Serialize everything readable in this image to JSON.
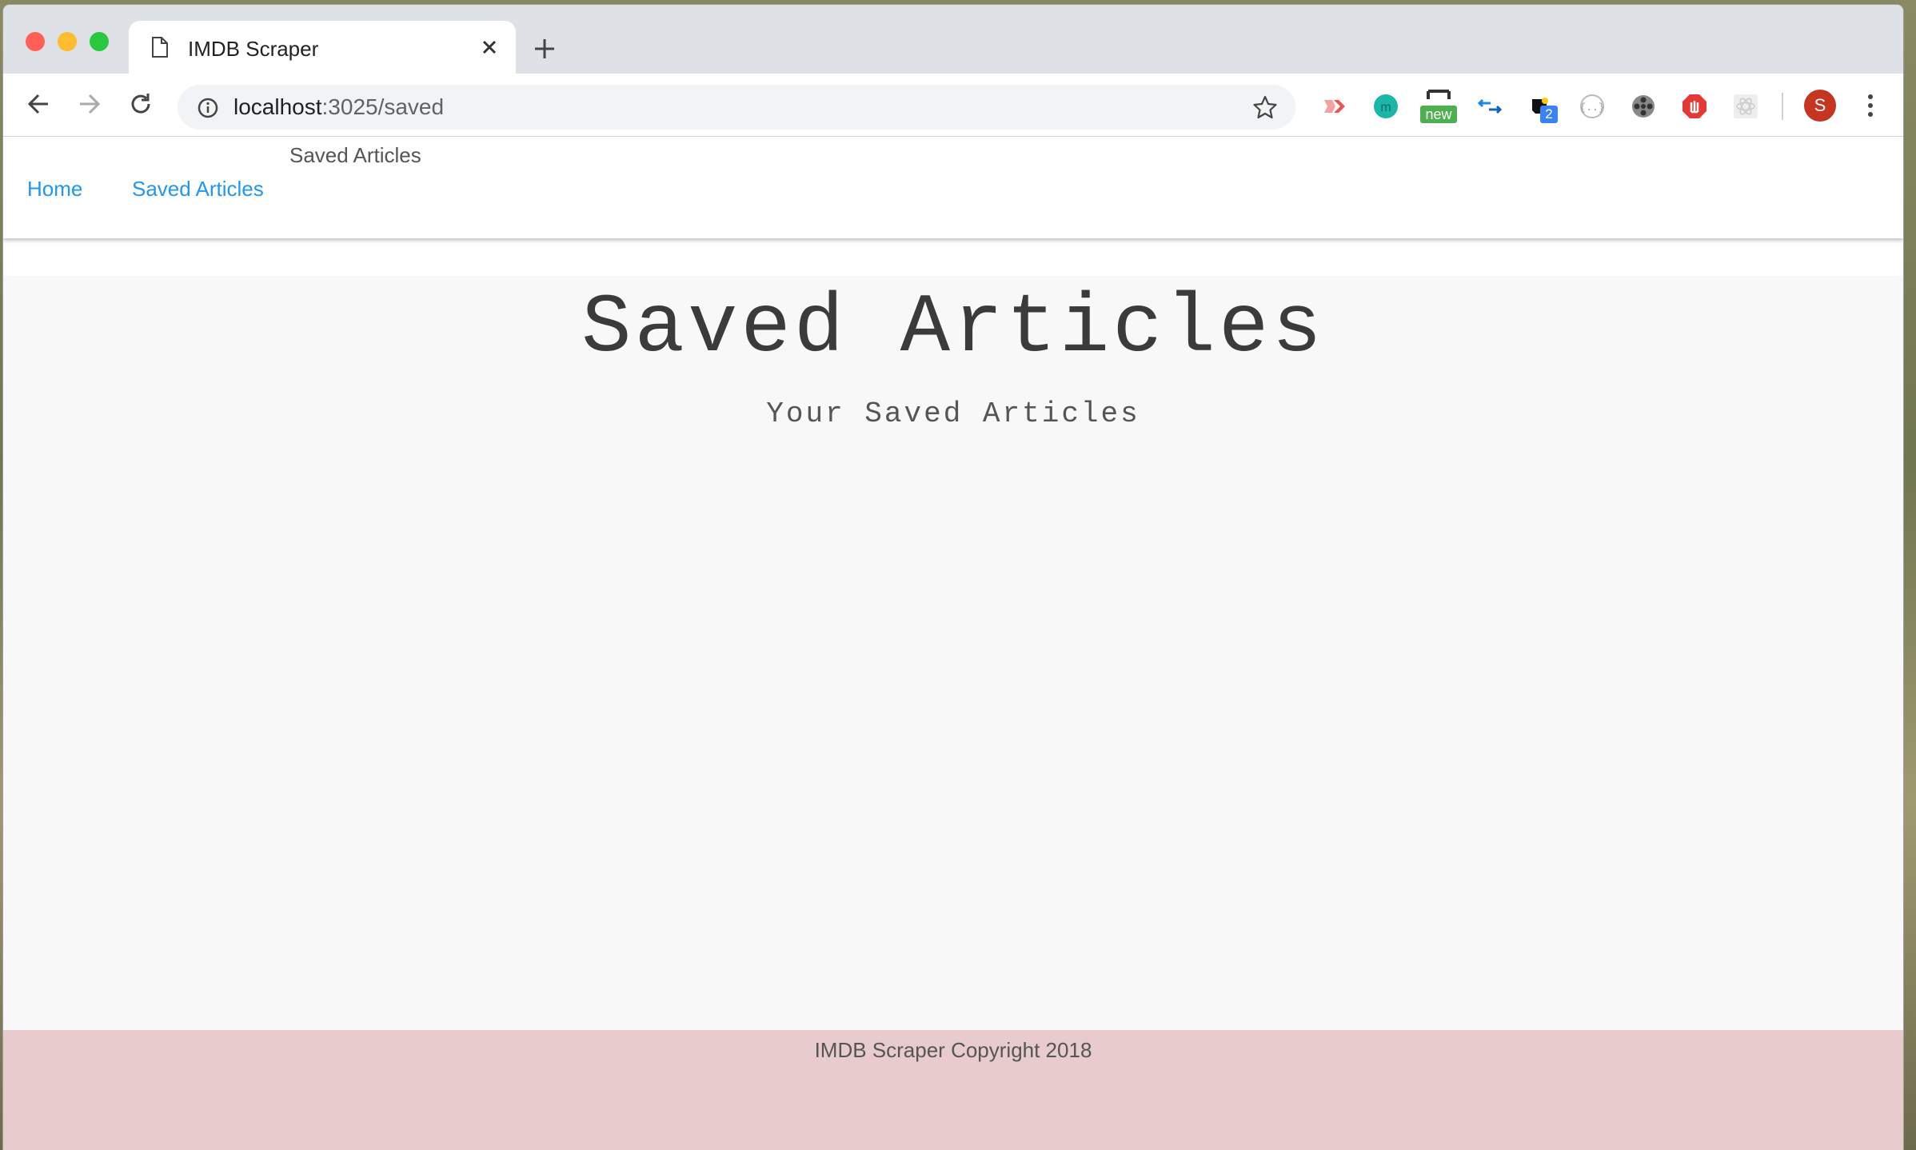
{
  "browser": {
    "tab_title": "IMDB Scraper",
    "url_host": "localhost",
    "url_path": ":3025/saved",
    "avatar_letter": "S",
    "extensions": [
      "vidyard-icon",
      "m-icon",
      "new-badge-icon",
      "arrows-icon",
      "evernote-icon",
      "json-icon",
      "film-reel-icon",
      "adblock-icon",
      "react-icon"
    ],
    "ext_badges": {
      "new": "new",
      "count": "2"
    }
  },
  "page": {
    "brand": "Saved Articles",
    "nav": [
      {
        "label": "Home"
      },
      {
        "label": "Saved Articles"
      }
    ],
    "title": "Saved Articles",
    "subtitle": "Your Saved Articles",
    "footer": "IMDB Scraper Copyright 2018"
  },
  "colors": {
    "link": "#2196f3",
    "footer_bg": "#e8cbcc",
    "main_bg": "#f8f8f8",
    "avatar": "#c5351f"
  }
}
